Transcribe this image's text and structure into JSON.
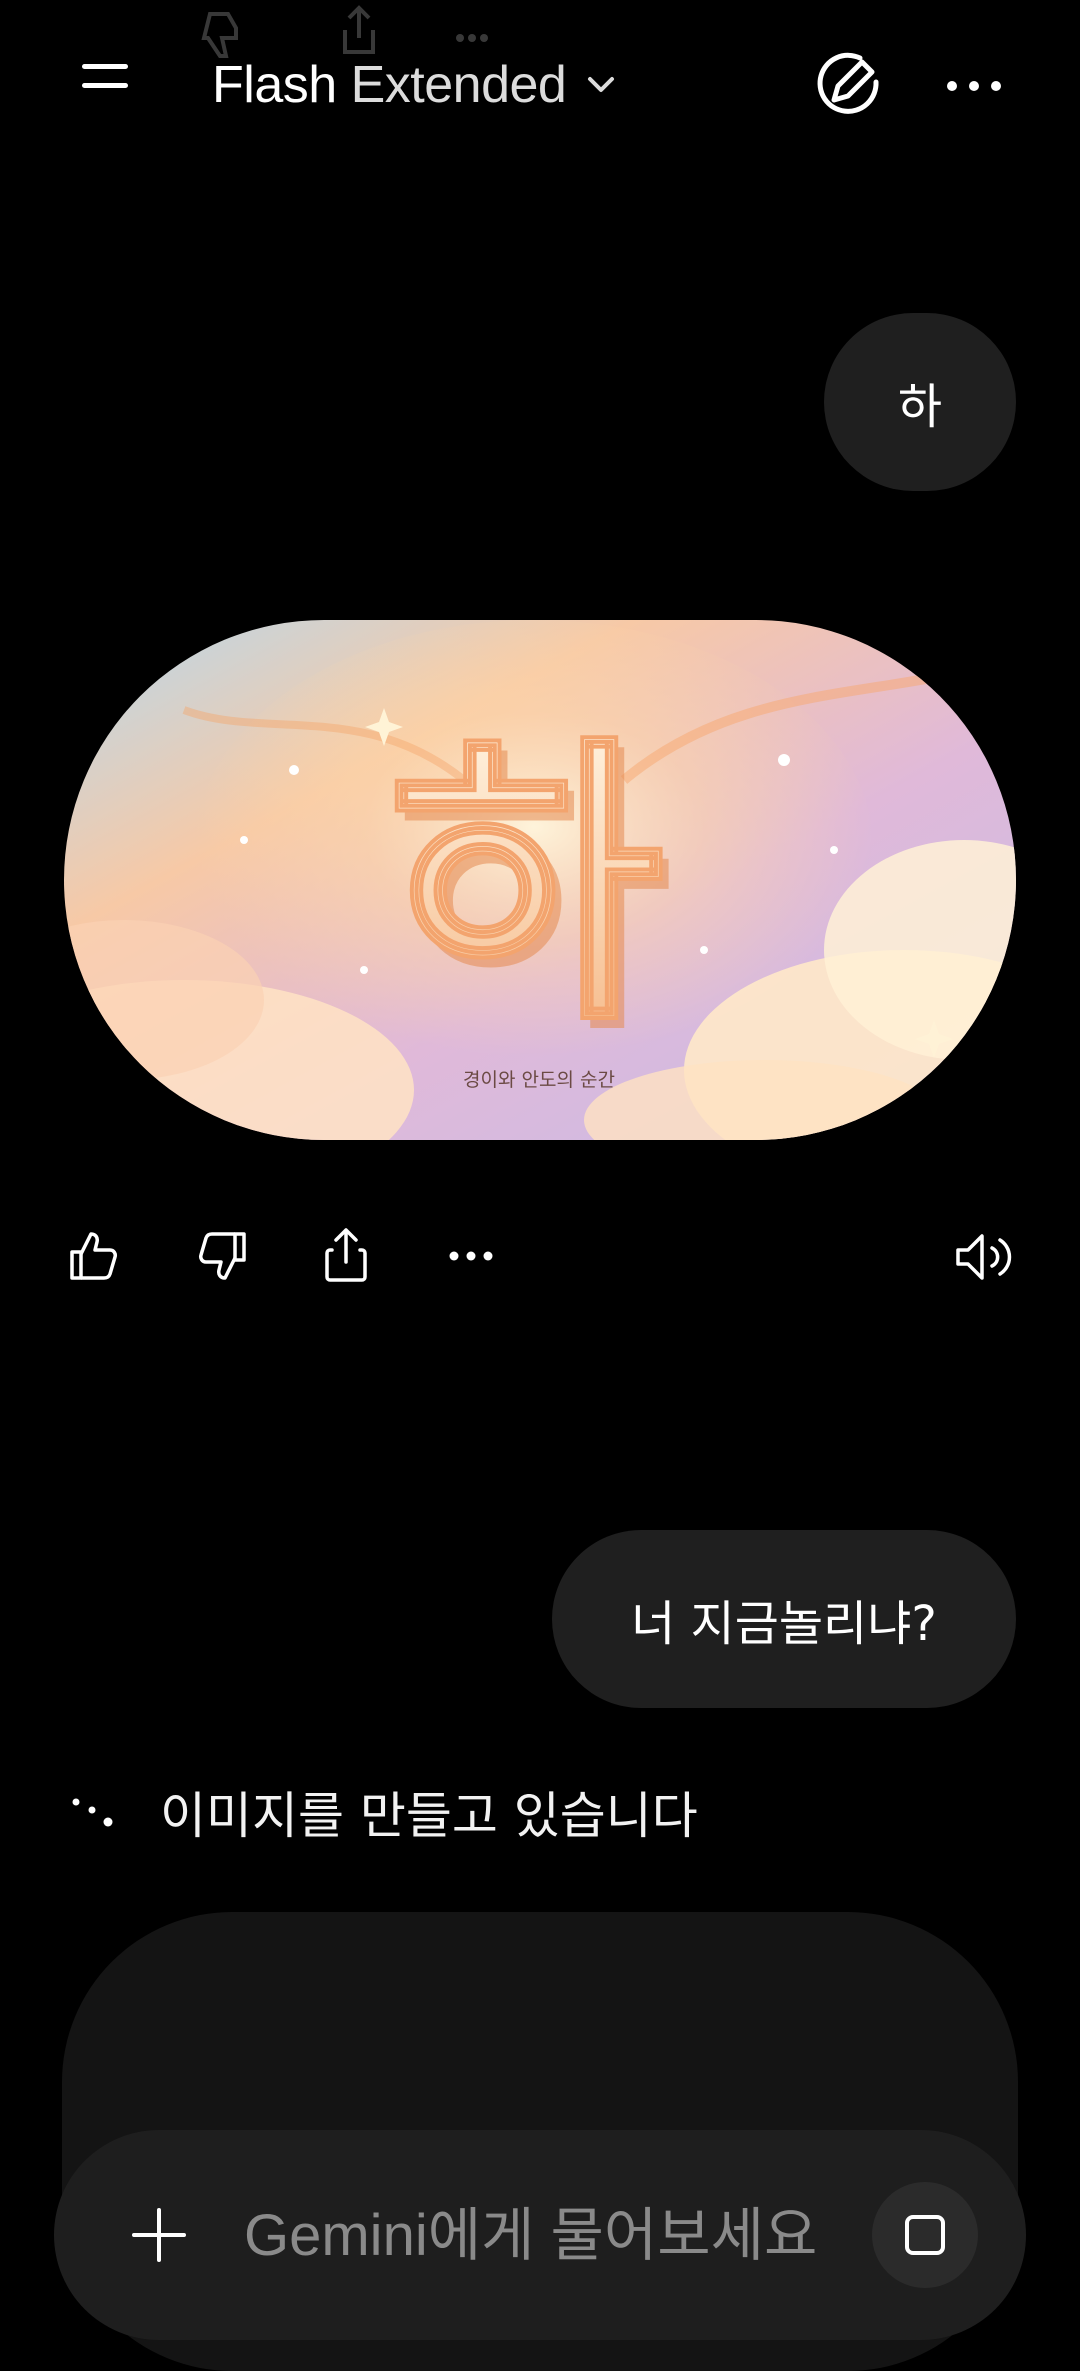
{
  "header": {
    "model_name_primary": "Flash",
    "model_name_secondary": "Extended"
  },
  "conversation": {
    "user_message_1": "하",
    "image": {
      "glyph": "하",
      "caption": "경이와 안도의 순간"
    },
    "user_message_2": "너 지금놀리냐?",
    "status_text": "이미지를 만들고 있습니다"
  },
  "input": {
    "placeholder": "Gemini에게 물어보세요"
  },
  "icons": {
    "menu": "hamburger-menu-icon",
    "dropdown": "chevron-down-icon",
    "new_chat": "edit-pen-icon",
    "more": "more-horizontal-icon",
    "like": "thumbs-up-icon",
    "dislike": "thumbs-down-icon",
    "share": "share-icon",
    "speaker": "speaker-icon",
    "add": "plus-icon",
    "stop": "stop-icon"
  }
}
